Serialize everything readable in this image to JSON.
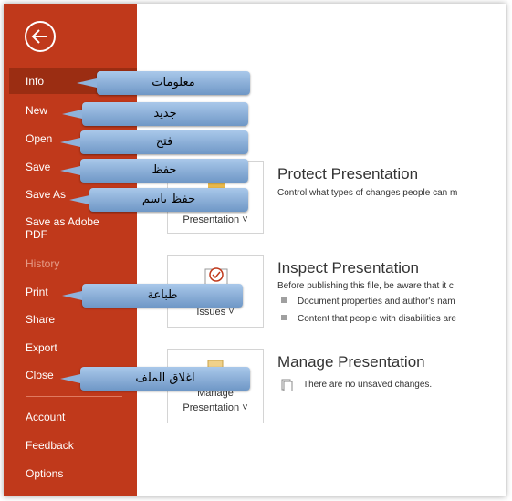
{
  "sidebar": {
    "back_label": "back",
    "items": [
      {
        "label": "Info"
      },
      {
        "label": "New"
      },
      {
        "label": "Open"
      },
      {
        "label": "Save"
      },
      {
        "label": "Save As"
      },
      {
        "label": "Save as Adobe PDF"
      },
      {
        "label": "History"
      },
      {
        "label": "Print"
      },
      {
        "label": "Share"
      },
      {
        "label": "Export"
      },
      {
        "label": "Close"
      },
      {
        "label": "Account"
      },
      {
        "label": "Feedback"
      },
      {
        "label": "Options"
      }
    ]
  },
  "main": {
    "protect": {
      "title": "Protect Presentation",
      "desc": "Control what types of changes people can m",
      "tile_label": "Presentation ˅"
    },
    "inspect": {
      "title": "Inspect Presentation",
      "desc": "Before publishing this file, be aware that it c",
      "bullets": [
        "Document properties and author's nam",
        "Content that people with disabilities are"
      ],
      "tile_label": "Issues ˅"
    },
    "manage": {
      "title": "Manage Presentation",
      "desc": "There are no unsaved changes.",
      "tile_label_1": "Manage",
      "tile_label_2": "Presentation ˅"
    }
  },
  "callouts": {
    "info": "معلومات",
    "new": "جديد",
    "open": "فتح",
    "save": "حفظ",
    "save_as": "حفظ باسم",
    "print": "طباعة",
    "close": "اغلاق الملف"
  },
  "colors": {
    "sidebar": "#c0391b",
    "active": "#9b2d12",
    "callout": "#8fb2db"
  }
}
